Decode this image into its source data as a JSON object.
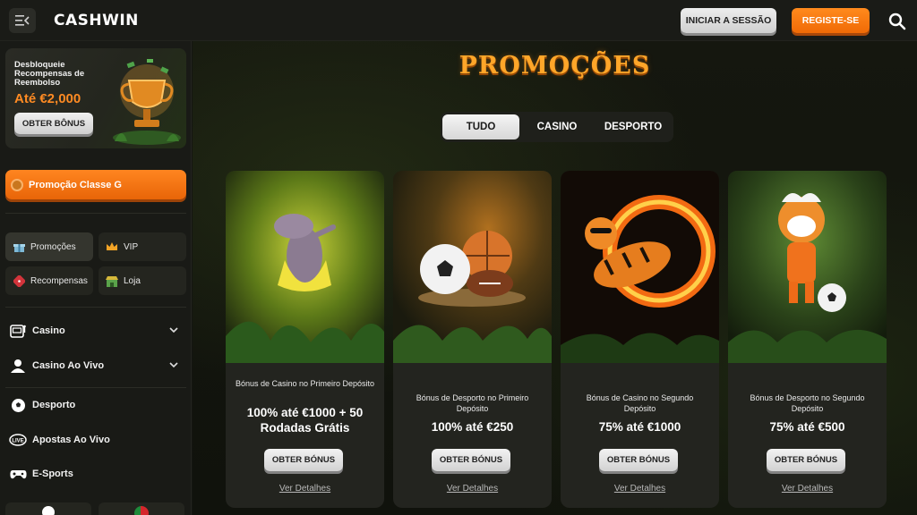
{
  "header": {
    "logo": "CASHWIN",
    "login_label": "INICIAR A SESSÃO",
    "register_label": "REGISTE-SE"
  },
  "sidebar": {
    "promo_card": {
      "text": "Desbloqueie Recompensas de Reembolso",
      "amount": "Até €2,000",
      "button": "OBTER BÔNUS"
    },
    "classe_button": "Promoção Classe G",
    "tiles": [
      {
        "label": "Promoções",
        "icon": "gift-icon",
        "active": true
      },
      {
        "label": "VIP",
        "icon": "crown-icon",
        "active": false
      },
      {
        "label": "Recompensas",
        "icon": "dice-icon",
        "active": false
      },
      {
        "label": "Loja",
        "icon": "shop-icon",
        "active": false
      }
    ],
    "nav": [
      {
        "label": "Casino",
        "icon": "slot-machine-icon",
        "expandable": true
      },
      {
        "label": "Casino Ao Vivo",
        "icon": "dealer-icon",
        "expandable": true
      },
      {
        "label": "Desporto",
        "icon": "soccer-ball-icon",
        "expandable": false
      },
      {
        "label": "Apostas Ao Vivo",
        "icon": "live-icon",
        "expandable": false
      },
      {
        "label": "E-Sports",
        "icon": "gamepad-icon",
        "expandable": false
      }
    ]
  },
  "main": {
    "title": "PROMOÇÕES",
    "tabs": [
      {
        "label": "TUDO",
        "active": true
      },
      {
        "label": "CASINO",
        "active": false
      },
      {
        "label": "DESPORTO",
        "active": false
      }
    ],
    "cards": [
      {
        "subtitle": "Bónus de Casino no Primeiro Depósito",
        "headline": "100% até €1000 + 50 Rodadas Grátis",
        "button": "OBTER BÓNUS",
        "link": "Ver Detalhes",
        "art": "hippo"
      },
      {
        "subtitle": "Bónus de Desporto no Primeiro Depósito",
        "headline": "100% até €250",
        "button": "OBTER BÓNUS",
        "link": "Ver Detalhes",
        "art": "balls"
      },
      {
        "subtitle": "Bónus de Casino no Segundo Depósito",
        "headline": "75% até €1000",
        "button": "OBTER BÓNUS",
        "link": "Ver Detalhes",
        "art": "fire-tiger"
      },
      {
        "subtitle": "Bónus de Desporto no Segundo Depósito",
        "headline": "75% até €500",
        "button": "OBTER BÓNUS",
        "link": "Ver Detalhes",
        "art": "tiger-soccer"
      }
    ]
  },
  "colors": {
    "accent_orange": "#f27310",
    "title_gold": "#ffa629",
    "panel": "#23241f",
    "background": "#141511"
  }
}
